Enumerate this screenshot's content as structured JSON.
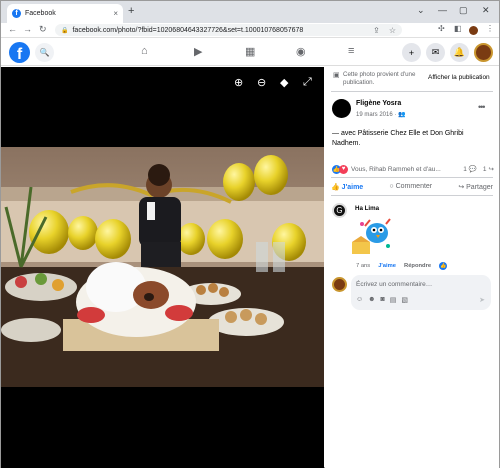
{
  "browser": {
    "tab_title": "Facebook",
    "tab_close": "×",
    "new_tab": "+",
    "window_controls": [
      "⌄",
      "—",
      "▢",
      "✕"
    ],
    "url": "facebook.com/photo/?fbid=10206804643327726&set=t.100010768057678"
  },
  "fb_nav": {
    "logo": "f",
    "icons": [
      "search-icon",
      "home-icon",
      "watch-icon",
      "marketplace-icon",
      "groups-icon",
      "menu-icon",
      "create-icon",
      "messenger-icon",
      "notifications-icon",
      "account-avatar"
    ]
  },
  "post": {
    "notice": "Cette photo provient d'une publication.",
    "show_post": "Afficher la publication",
    "author": "Fligène Yosra",
    "date": "19 mars 2016 · ",
    "caption_prefix": "— avec ",
    "tag1": "Pâtisserie Chez Elle",
    "caption_and": " et ",
    "tag2": "Don Ghribi Nadhem",
    "caption_suffix": ".",
    "reactions_text": "Vous, Rihab Rammeh et d'au...",
    "comments_count": "1",
    "shares_count": "1"
  },
  "actions": {
    "like": "J'aime",
    "comment": "Commenter",
    "share": "Partager"
  },
  "comment": {
    "author": "Ha Lima",
    "age": "7 ans",
    "like": "J'aime",
    "reply": "Répondre"
  },
  "input": {
    "placeholder": "Écrivez un commentaire…"
  },
  "colors": {
    "fb_blue": "#1877f2",
    "background": "#ffffff",
    "photo_bg": "#000000"
  }
}
